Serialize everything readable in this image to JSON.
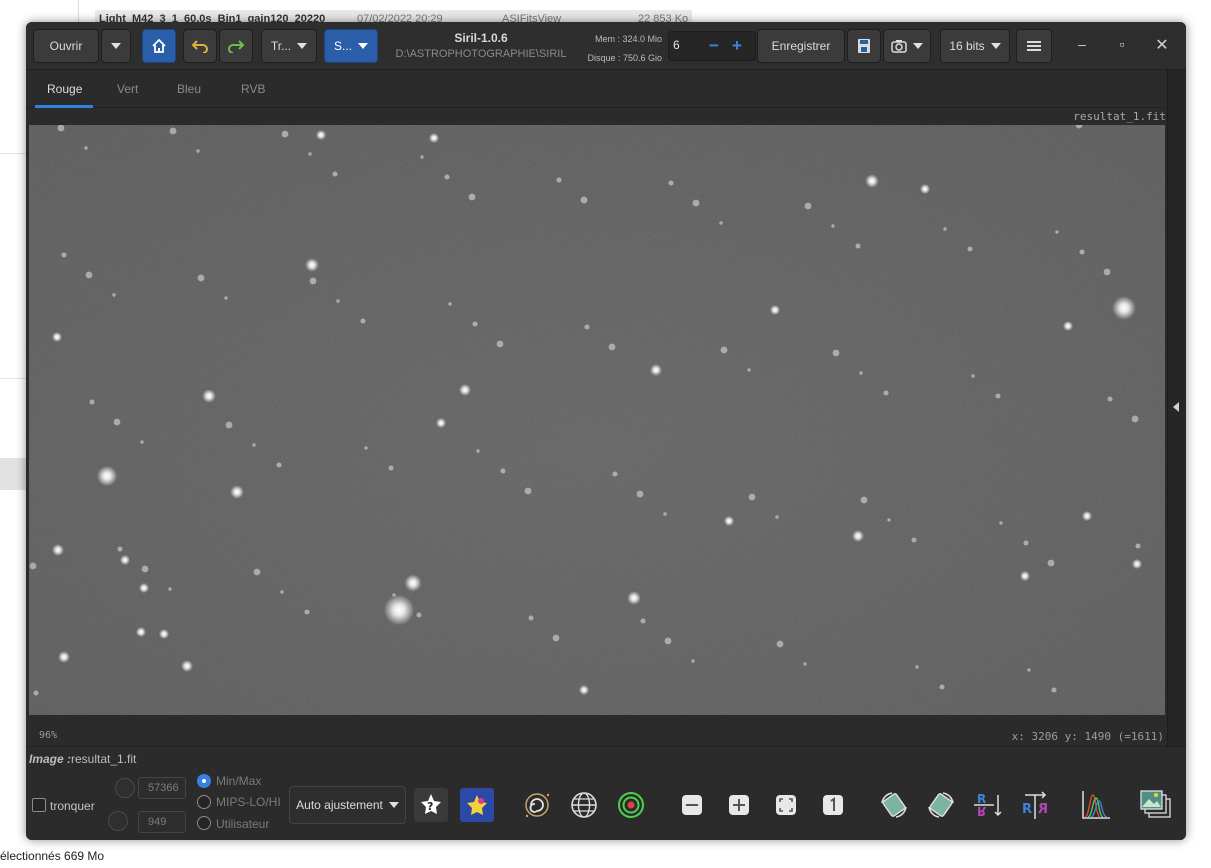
{
  "background": {
    "file_row": {
      "name": "Light_M42_3_1_60.0s_Bin1_gain120_20220",
      "date": "07/02/2022 20:29",
      "app": "ASIFitsView",
      "size": "22 853 Ko"
    },
    "status_text": "électionnés  669 Mo"
  },
  "header": {
    "open_label": "Ouvrir",
    "process_label": "Tr...",
    "scripts_label": "S...",
    "app_title": "Siril-1.0.6",
    "working_dir": "D:\\ASTROPHOTOGRAPHIE\\SIRIL",
    "mem_label": "Mem : 324.0 Mio",
    "disk_label": "Disque : 750.6 Gio",
    "threads_value": "6",
    "save_label": "Enregistrer",
    "bitdepth_label": "16 bits",
    "minimize_icon": "minimize-icon",
    "maximize_icon": "maximize-icon",
    "close_icon": "close-icon"
  },
  "tabs": [
    {
      "label": "Rouge",
      "active": true
    },
    {
      "label": "Vert",
      "active": false
    },
    {
      "label": "Bleu",
      "active": false
    },
    {
      "label": "RVB",
      "active": false
    }
  ],
  "image": {
    "filename": "resultat_1.fit",
    "zoom": "96%",
    "coords": "x: 3206 y: 1490 (=1611)"
  },
  "bottom": {
    "image_prefix": "Image :",
    "image_name": "resultat_1.fit",
    "crop_label": "tronquer",
    "high_value": "57366",
    "low_value": "949",
    "radio_minmax": "Min/Max",
    "radio_mips": "MIPS-LO/HI",
    "radio_user": "Utilisateur",
    "stretch_label": "Auto ajustement"
  },
  "colors": {
    "accent": "#3581e0",
    "button_blue": "#2a5ea8",
    "window_bg": "#2b2b2b",
    "sky": "#5a5a5a"
  }
}
